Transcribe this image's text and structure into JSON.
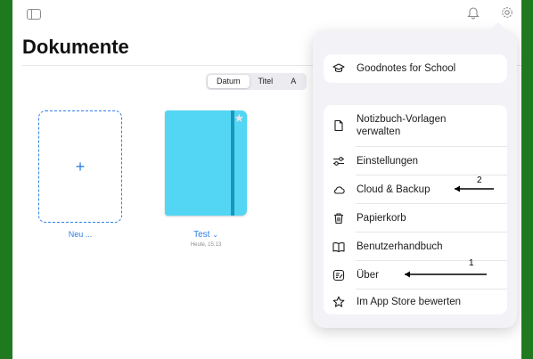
{
  "toolbar": {
    "sidebar_icon": "sidebar-icon",
    "bell_icon": "bell-icon",
    "gear_icon": "gear-icon"
  },
  "page": {
    "title": "Dokumente"
  },
  "sort": {
    "options": [
      "Datum",
      "Titel",
      "A"
    ],
    "selected": "Datum"
  },
  "new_document": {
    "label": "Neu ..."
  },
  "notebook": {
    "title": "Test",
    "chevron": "⌄",
    "date": "Heute, 15:13",
    "color": "#53d6f3"
  },
  "menu": {
    "top_item": {
      "label": "Goodnotes for School",
      "icon": "graduation-cap-icon"
    },
    "items": [
      {
        "label": "Notizbuch-Vorlagen verwalten",
        "icon": "document-icon"
      },
      {
        "label": "Einstellungen",
        "icon": "sliders-icon"
      },
      {
        "label": "Cloud & Backup",
        "icon": "cloud-icon"
      },
      {
        "label": "Papierkorb",
        "icon": "trash-icon"
      },
      {
        "label": "Benutzerhandbuch",
        "icon": "book-icon"
      },
      {
        "label": "Über",
        "icon": "info-note-icon"
      },
      {
        "label": "Im App Store bewerten",
        "icon": "star-icon"
      }
    ]
  },
  "annotations": [
    {
      "number": "1"
    },
    {
      "number": "2"
    }
  ]
}
